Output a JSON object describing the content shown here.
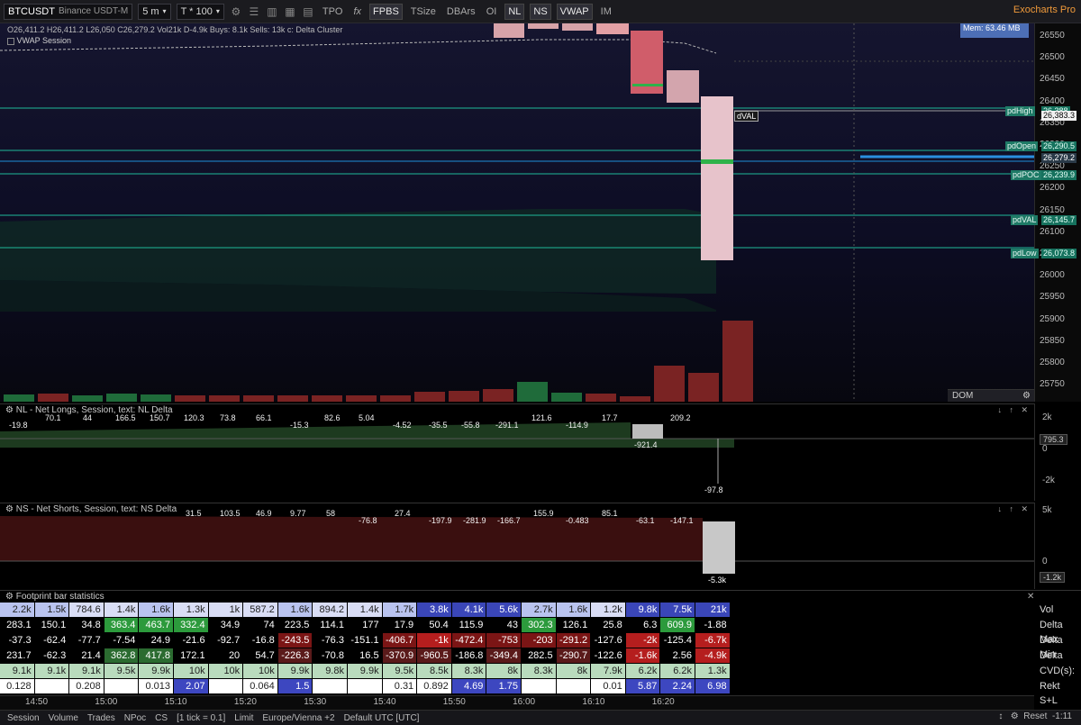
{
  "toolbar": {
    "symbol": "BTCUSDT",
    "exchange": "Binance USDT-M",
    "timeframe": "5 m",
    "ticks": "T * 100",
    "buttons": [
      "TPO",
      "FPBS",
      "TSize",
      "DBArs",
      "OI",
      "NL",
      "NS",
      "VWAP",
      "IM"
    ],
    "fx_label": "fx",
    "brand": "Exocharts Pro"
  },
  "chart": {
    "ohlc": "O26,411.2 H26,411.2 L26,050 C26,279.2 Vol21k D-4.9k Buys: 8.1k Sells: 13k  c: Delta Cluster",
    "vwap_session": "VWAP Session",
    "memory": "Mem: 63.46 MB",
    "dval": "dVAL",
    "price_ticks": [
      "26550",
      "26500",
      "26450",
      "26400",
      "26350",
      "26300",
      "26250",
      "26200",
      "26150",
      "26100",
      "26050",
      "26000",
      "25950",
      "25900",
      "25850",
      "25800",
      "25750"
    ],
    "levels": [
      {
        "tag": "pdHigh",
        "value": "26,388",
        "color": "#1fb99a"
      },
      {
        "tag": "",
        "value": "26,383.3",
        "color": "#f0f0f0"
      },
      {
        "tag": "pdOpen",
        "value": "26,290.5",
        "color": "#1fb99a"
      },
      {
        "tag": "",
        "value": "26,279.2",
        "color": "#1f8fd8"
      },
      {
        "tag": "pdPOC",
        "value": "26,239.9",
        "color": "#1fb99a"
      },
      {
        "tag": "pdVAL",
        "value": "26,145.7",
        "color": "#1fb99a"
      },
      {
        "tag": "pdLow",
        "value": "26,073.8",
        "color": "#1fb99a"
      }
    ],
    "dom_label": "DOM"
  },
  "nl_pane": {
    "title": "NL - Net Longs, Session, text: NL Delta",
    "axis_ticks": [
      "2k",
      "0",
      "-2k"
    ],
    "current": "795.3",
    "labels": [
      "-19.8",
      "70.1",
      "44",
      "166.5",
      "150.7",
      "120.3",
      "73.8",
      "66.1",
      "-15.3",
      "82.6",
      "5.04",
      "-4.52",
      "-35.5",
      "-55.8",
      "-291.1",
      "121.6",
      "-114.9",
      "17.7",
      "-921.4",
      "209.2",
      "-97.8"
    ]
  },
  "ns_pane": {
    "title": "NS - Net Shorts, Session, text: NS Delta",
    "axis_ticks": [
      "5k",
      "0"
    ],
    "current": "-1.2k",
    "labels": [
      "31.5",
      "103.5",
      "46.9",
      "9.77",
      "58",
      "-76.8",
      "27.4",
      "-197.9",
      "-281.9",
      "-166.7",
      "155.9",
      "-0.483",
      "85.1",
      "-63.1",
      "-147.1",
      "-5.3k"
    ]
  },
  "stats": {
    "title": "Footprint bar statistics",
    "row_labels": [
      "Vol",
      "Delta Max",
      "Delta Min",
      "Delta",
      "CVD(s):",
      "Rekt S+L"
    ],
    "rows": [
      [
        "2.2k",
        "1.5k",
        "784.6",
        "1.4k",
        "1.6k",
        "1.3k",
        "1k",
        "587.2",
        "1.6k",
        "894.2",
        "1.4k",
        "1.7k",
        "3.8k",
        "4.1k",
        "5.6k",
        "2.7k",
        "1.6k",
        "1.2k",
        "9.8k",
        "7.5k",
        "21k"
      ],
      [
        "283.1",
        "150.1",
        "34.8",
        "363.4",
        "463.7",
        "332.4",
        "34.9",
        "74",
        "223.5",
        "114.1",
        "177",
        "17.9",
        "50.4",
        "115.9",
        "43",
        "302.3",
        "126.1",
        "25.8",
        "6.3",
        "609.9",
        "-1.88"
      ],
      [
        "-37.3",
        "-62.4",
        "-77.7",
        "-7.54",
        "24.9",
        "-21.6",
        "-92.7",
        "-16.8",
        "-243.5",
        "-76.3",
        "-151.1",
        "-406.7",
        "-1k",
        "-472.4",
        "-753",
        "-203",
        "-291.2",
        "-127.6",
        "-2k",
        "-125.4",
        "-6.7k"
      ],
      [
        "231.7",
        "-62.3",
        "21.4",
        "362.8",
        "417.8",
        "172.1",
        "20",
        "54.7",
        "-226.3",
        "-70.8",
        "16.5",
        "-370.9",
        "-960.5",
        "-186.8",
        "-349.4",
        "282.5",
        "-290.7",
        "-122.6",
        "-1.6k",
        "2.56",
        "-4.9k"
      ],
      [
        "9.1k",
        "9.1k",
        "9.1k",
        "9.5k",
        "9.9k",
        "10k",
        "10k",
        "10k",
        "9.9k",
        "9.8k",
        "9.9k",
        "9.5k",
        "8.5k",
        "8.3k",
        "8k",
        "8.3k",
        "8k",
        "7.9k",
        "6.2k",
        "6.2k",
        "1.3k"
      ],
      [
        "0.128",
        "",
        "0.208",
        "",
        "0.013",
        "2.07",
        "",
        "0.064",
        "1.5",
        "",
        "",
        "0.31",
        "0.892",
        "4.69",
        "1.75",
        "",
        "",
        "0.01",
        "5.87",
        "2.24",
        "6.98"
      ]
    ]
  },
  "time_ticks": [
    "14:50",
    "15:00",
    "15:10",
    "15:20",
    "15:30",
    "15:40",
    "15:50",
    "16:00",
    "16:10",
    "16:20"
  ],
  "statusbar": {
    "items": [
      "Session",
      "Volume",
      "Trades",
      "NPoc",
      "CS",
      "[1 tick = 0.1]",
      "Limit",
      "Europe/Vienna +2",
      "Default UTC [UTC]"
    ],
    "right_time": "-1:11",
    "reset": "Reset"
  }
}
